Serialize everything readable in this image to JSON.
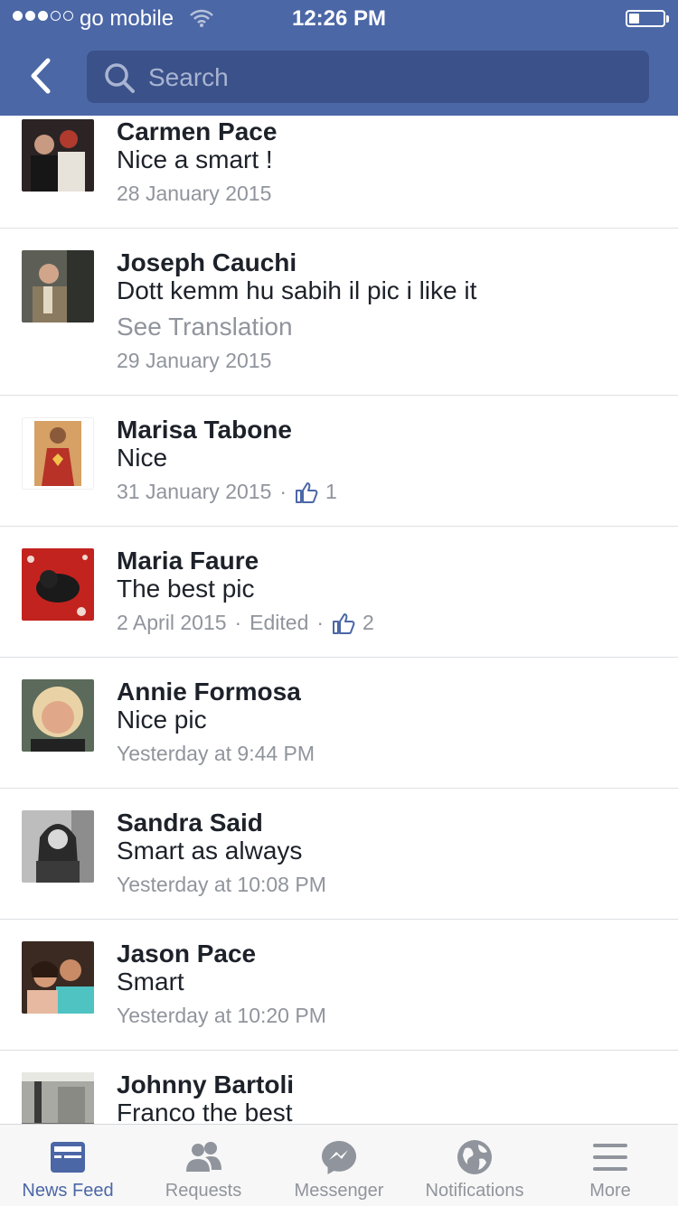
{
  "status_bar": {
    "carrier": "go mobile",
    "time": "12:26 PM",
    "signal_bars": 3,
    "battery_level": 0.3
  },
  "header": {
    "search_placeholder": "Search",
    "back_icon": "chevron-left-icon",
    "search_icon": "search-icon"
  },
  "comments": [
    {
      "name": "Carmen Pace",
      "text": "Nice a smart !",
      "date": "28 January 2015",
      "avatar_color": "#3a3030"
    },
    {
      "name": "Joseph Cauchi",
      "text": "Dott kemm hu sabih il pic i like it",
      "translation": "See Translation",
      "date": "29 January 2015",
      "avatar_color": "#6e7166"
    },
    {
      "name": "Marisa Tabone",
      "text": "Nice",
      "date": "31 January 2015",
      "likes": "1",
      "avatar_color": "#d7a064"
    },
    {
      "name": "Maria Faure",
      "text": "The best pic",
      "date": "2 April 2015",
      "edited": "Edited",
      "likes": "2",
      "avatar_color": "#c3231f"
    },
    {
      "name": "Annie Formosa",
      "text": "Nice pic",
      "date": "Yesterday at 9:44 PM",
      "avatar_color": "#c9a78d"
    },
    {
      "name": "Sandra Said",
      "text": "Smart as always",
      "date": "Yesterday at 10:08 PM",
      "avatar_color": "#8a8a8a"
    },
    {
      "name": "Jason Pace",
      "text": "Smart",
      "date": "Yesterday at 10:20 PM",
      "avatar_color": "#b77854"
    },
    {
      "name": "Johnny Bartoli",
      "text": "Franco the best",
      "date": "",
      "avatar_color": "#7c7c78"
    }
  ],
  "tabs": [
    {
      "label": "News Feed",
      "icon": "news-feed-icon",
      "active": true
    },
    {
      "label": "Requests",
      "icon": "friend-requests-icon",
      "active": false
    },
    {
      "label": "Messenger",
      "icon": "messenger-icon",
      "active": false
    },
    {
      "label": "Notifications",
      "icon": "globe-icon",
      "active": false
    },
    {
      "label": "More",
      "icon": "menu-icon",
      "active": false
    }
  ],
  "colors": {
    "header_blue": "#4b67a6",
    "search_field": "#3b5189",
    "meta_gray": "#90949c",
    "active_tab": "#4b67a6",
    "like_icon": "#4b67a6"
  }
}
